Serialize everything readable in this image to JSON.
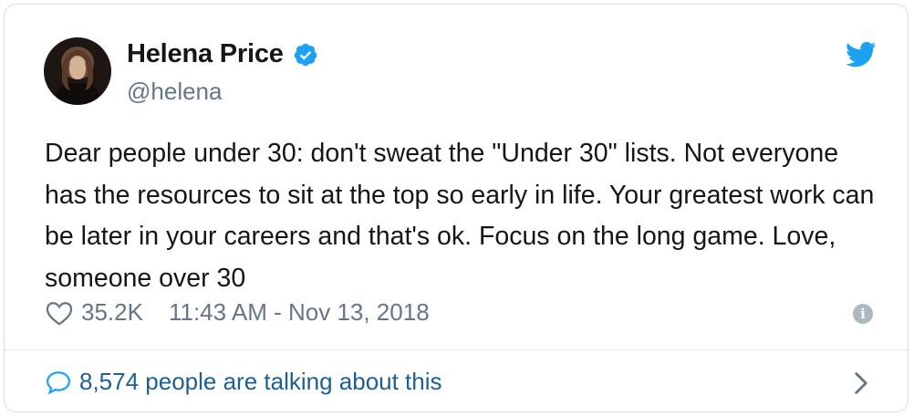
{
  "author": {
    "name": "Helena Price",
    "handle": "@helena",
    "verified": true
  },
  "tweet": {
    "text": "Dear people under 30: don't sweat the \"Under 30\" lists. Not everyone has the resources to sit at the top so early in life. Your greatest work can be later in your careers and that's ok. Focus on the long game. Love, someone over 30",
    "likes": "35.2K",
    "timestamp": "11:43 AM - Nov 13, 2018"
  },
  "footer": {
    "conversation_label": "8,574 people are talking about this"
  },
  "icons": {
    "brand": "twitter-bird-icon",
    "verified": "verified-badge-icon",
    "like": "heart-icon",
    "info": "info-icon",
    "conversation": "speech-bubble-icon",
    "chevron": "chevron-right-icon"
  },
  "colors": {
    "twitter_blue": "#1da1f2",
    "link_blue": "#1b5f95",
    "muted_gray": "#657786",
    "text_dark": "#14171a"
  }
}
